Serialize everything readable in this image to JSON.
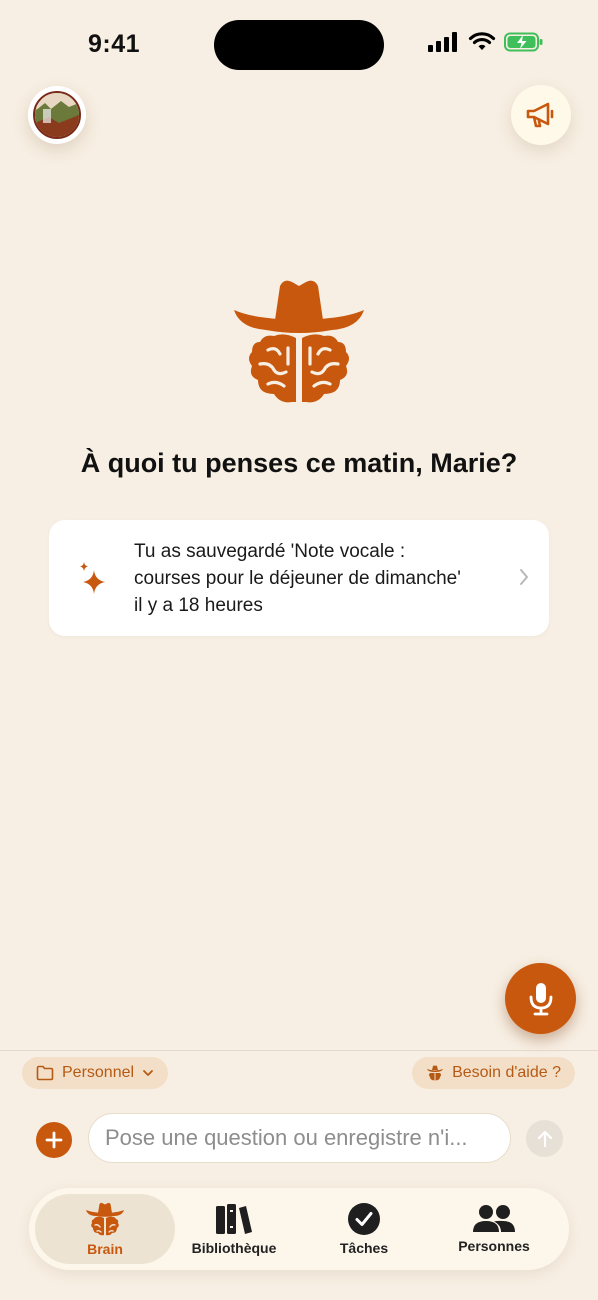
{
  "status_bar": {
    "time": "9:41"
  },
  "colors": {
    "accent": "#c8580e",
    "background": "#f7efe3",
    "chip_bg": "#f3dfc8"
  },
  "header": {
    "avatar_icon": "user-avatar-photo",
    "announce_icon": "megaphone-icon"
  },
  "main": {
    "greeting": "À quoi tu penses ce matin, Marie?",
    "recent_card": {
      "icon": "sparkle-icon",
      "text": "Tu as sauvegardé 'Note vocale : courses pour le déjeuner de dimanche' il y a 18 heures"
    }
  },
  "composer": {
    "folder_chip": "Personnel",
    "help_chip": "Besoin d'aide ?",
    "input_placeholder": "Pose une question ou enregistre n'i..."
  },
  "tabbar": {
    "tabs": [
      {
        "label": "Brain",
        "icon": "cowboy-brain-icon",
        "active": true
      },
      {
        "label": "Bibliothèque",
        "icon": "books-icon",
        "active": false
      },
      {
        "label": "Tâches",
        "icon": "checkmark-circle-icon",
        "active": false
      },
      {
        "label": "Personnes",
        "icon": "people-icon",
        "active": false
      }
    ]
  }
}
